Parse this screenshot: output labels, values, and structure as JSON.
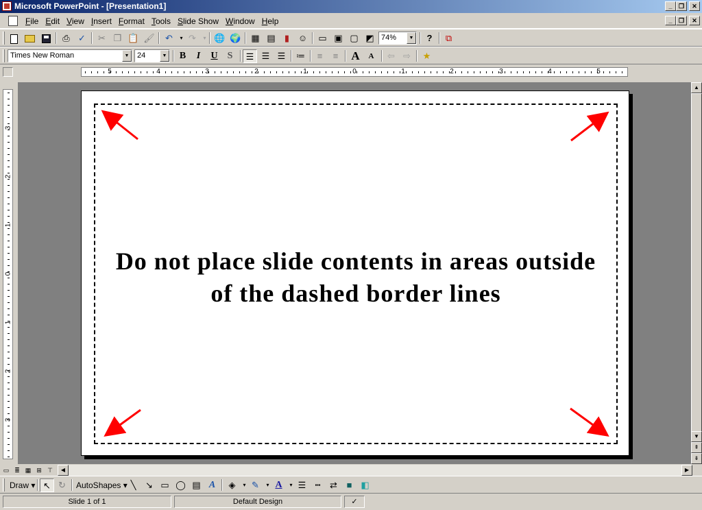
{
  "window": {
    "title": "Microsoft PowerPoint - [Presentation1]",
    "app_controls": [
      "_",
      "❐",
      "✕"
    ],
    "doc_controls": [
      "_",
      "❐",
      "✕"
    ]
  },
  "menu": {
    "items": [
      "File",
      "Edit",
      "View",
      "Insert",
      "Format",
      "Tools",
      "Slide Show",
      "Window",
      "Help"
    ]
  },
  "standard_toolbar": {
    "zoom": "74%",
    "help_glyph": "?"
  },
  "formatting_toolbar": {
    "font": "Times New Roman",
    "font_size": "24",
    "bold": "B",
    "italic": "I",
    "underline": "U",
    "shadow": "S",
    "grow": "A",
    "shrink": "A"
  },
  "ruler": {
    "h_labels": [
      "5",
      "4",
      "3",
      "2",
      "1",
      "0",
      "1",
      "2",
      "3",
      "4",
      "5"
    ],
    "v_labels": [
      "3",
      "2",
      "1",
      "0",
      "1",
      "2",
      "3"
    ]
  },
  "slide": {
    "text_line1": "Do not place slide contents in areas outside",
    "text_line2": "of the dashed border lines",
    "arrow_color": "#ff0000"
  },
  "draw_toolbar": {
    "draw_label": "Draw",
    "autoshapes_label": "AutoShapes",
    "text_a": "A"
  },
  "status": {
    "slide": "Slide 1 of 1",
    "design": "Default Design"
  }
}
